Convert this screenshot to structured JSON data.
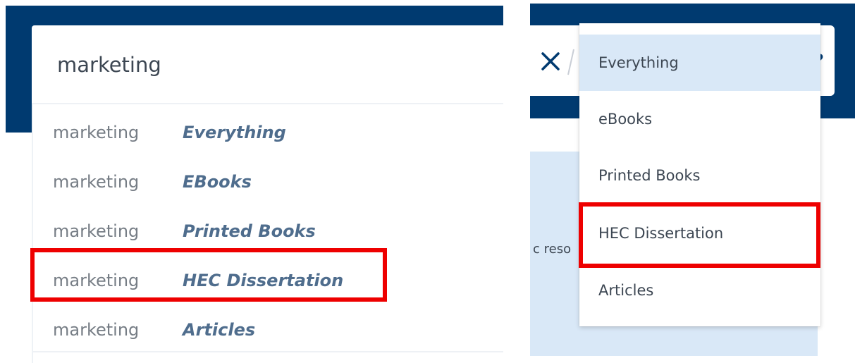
{
  "left_panel": {
    "search": {
      "value": "marketing"
    },
    "suggestions": [
      {
        "term": "marketing",
        "scope": "Everything"
      },
      {
        "term": "marketing",
        "scope": "EBooks"
      },
      {
        "term": "marketing",
        "scope": "Printed Books"
      },
      {
        "term": "marketing",
        "scope": "HEC Dissertation"
      },
      {
        "term": "marketing",
        "scope": "Articles"
      }
    ]
  },
  "right_panel": {
    "scope_dropdown": {
      "options": [
        "Everything",
        "eBooks",
        "Printed Books",
        "HEC Dissertation",
        "Articles"
      ],
      "selected": "Everything"
    },
    "background_text": "c reso"
  },
  "colors": {
    "header_navy": "#003a70",
    "highlight_red": "#ee0000",
    "selected_bg": "#d9e8f7",
    "scope_text": "#4f6d8d"
  }
}
